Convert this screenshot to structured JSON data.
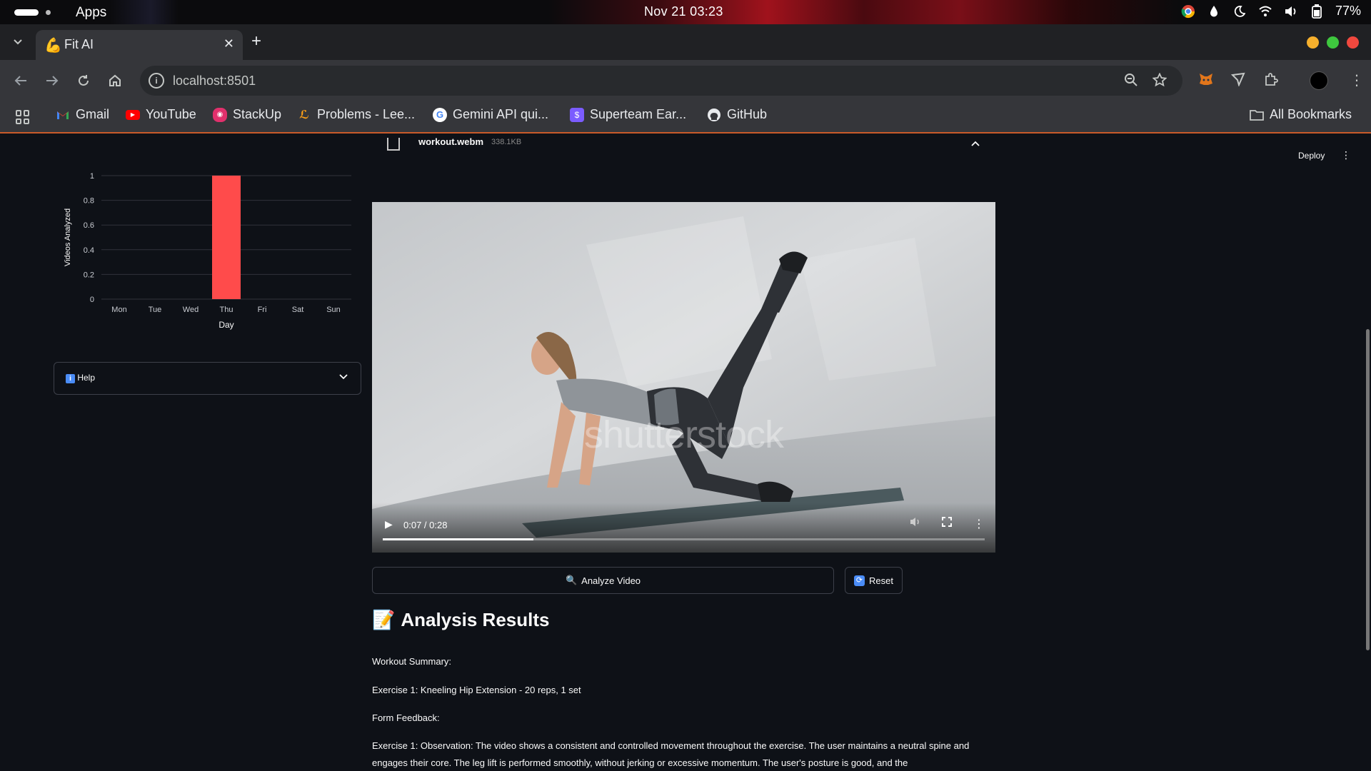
{
  "os": {
    "apps_label": "Apps",
    "clock": "Nov 21  03:23",
    "battery": "77%"
  },
  "browser": {
    "tab_title": "Fit AI",
    "tab_favicon": "💪",
    "url": "localhost:8501",
    "bookmarks": [
      {
        "label": "Gmail",
        "icon": "gmail-icon"
      },
      {
        "label": "YouTube",
        "icon": "youtube-icon"
      },
      {
        "label": "StackUp",
        "icon": "stackup-icon"
      },
      {
        "label": "Problems - Lee...",
        "icon": "leetcode-icon"
      },
      {
        "label": "Gemini API qui...",
        "icon": "google-icon"
      },
      {
        "label": "Superteam Ear...",
        "icon": "superteam-icon"
      },
      {
        "label": "GitHub",
        "icon": "github-icon"
      }
    ],
    "all_bookmarks": "All Bookmarks"
  },
  "app": {
    "deploy_label": "Deploy",
    "help_label": "Help",
    "file": {
      "name": "workout.webm",
      "size": "338.1KB"
    },
    "video": {
      "time": "0:07 / 0:28",
      "progress": 0.25,
      "watermark": "shutterstock"
    },
    "analyze_label": "Analyze Video",
    "reset_label": "Reset",
    "results_title": "Analysis Results",
    "results_icon": "📝",
    "summary_heading": "Workout Summary:",
    "exercise_line": "Exercise 1: Kneeling Hip Extension - 20 reps, 1 set",
    "feedback_heading": "Form Feedback:",
    "observation": "Exercise 1: Observation: The video shows a consistent and controlled movement throughout the exercise. The user maintains a neutral spine and engages their core. The leg lift is performed smoothly, without jerking or excessive momentum. The user's posture is good, and the"
  },
  "chart_data": {
    "type": "bar",
    "categories": [
      "Mon",
      "Tue",
      "Wed",
      "Thu",
      "Fri",
      "Sat",
      "Sun"
    ],
    "values": [
      0,
      0,
      0,
      1,
      0,
      0,
      0
    ],
    "xlabel": "Day",
    "ylabel": "Videos Analyzed",
    "yticks": [
      "0",
      "0.2",
      "0.4",
      "0.6",
      "0.8",
      "1"
    ],
    "ylim": [
      0,
      1
    ],
    "bar_color": "#ff4b4b",
    "grid": true
  }
}
